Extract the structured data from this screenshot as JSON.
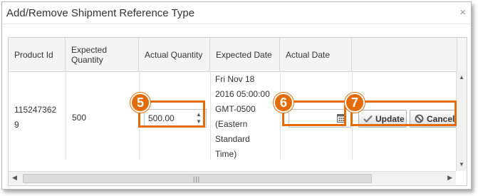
{
  "dialog": {
    "title": "Add/Remove Shipment Reference Type",
    "close_glyph": "×"
  },
  "grid": {
    "columns": [
      "Product Id",
      "Expected Quantity",
      "Actual Quantity",
      "Expected Date",
      "Actual Date",
      ""
    ],
    "row": {
      "product_id_line1": "115247362",
      "product_id_line2": "9",
      "expected_quantity": "500",
      "actual_quantity_value": "500.00",
      "expected_date_lines": [
        "Fri Nov 18",
        "2016 05:00:00",
        "GMT-0500",
        "(Eastern",
        "Standard",
        "Time)"
      ],
      "actual_date_value": ""
    },
    "buttons": {
      "update": "Update",
      "cancel": "Cancel"
    }
  },
  "callouts": {
    "qty": "5",
    "date": "6",
    "actions": "7"
  },
  "icons": {
    "close": "close-icon",
    "calendar": "calendar-icon",
    "update": "check-icon",
    "cancel": "ban-icon"
  },
  "colors": {
    "callout": "#e36c09"
  }
}
